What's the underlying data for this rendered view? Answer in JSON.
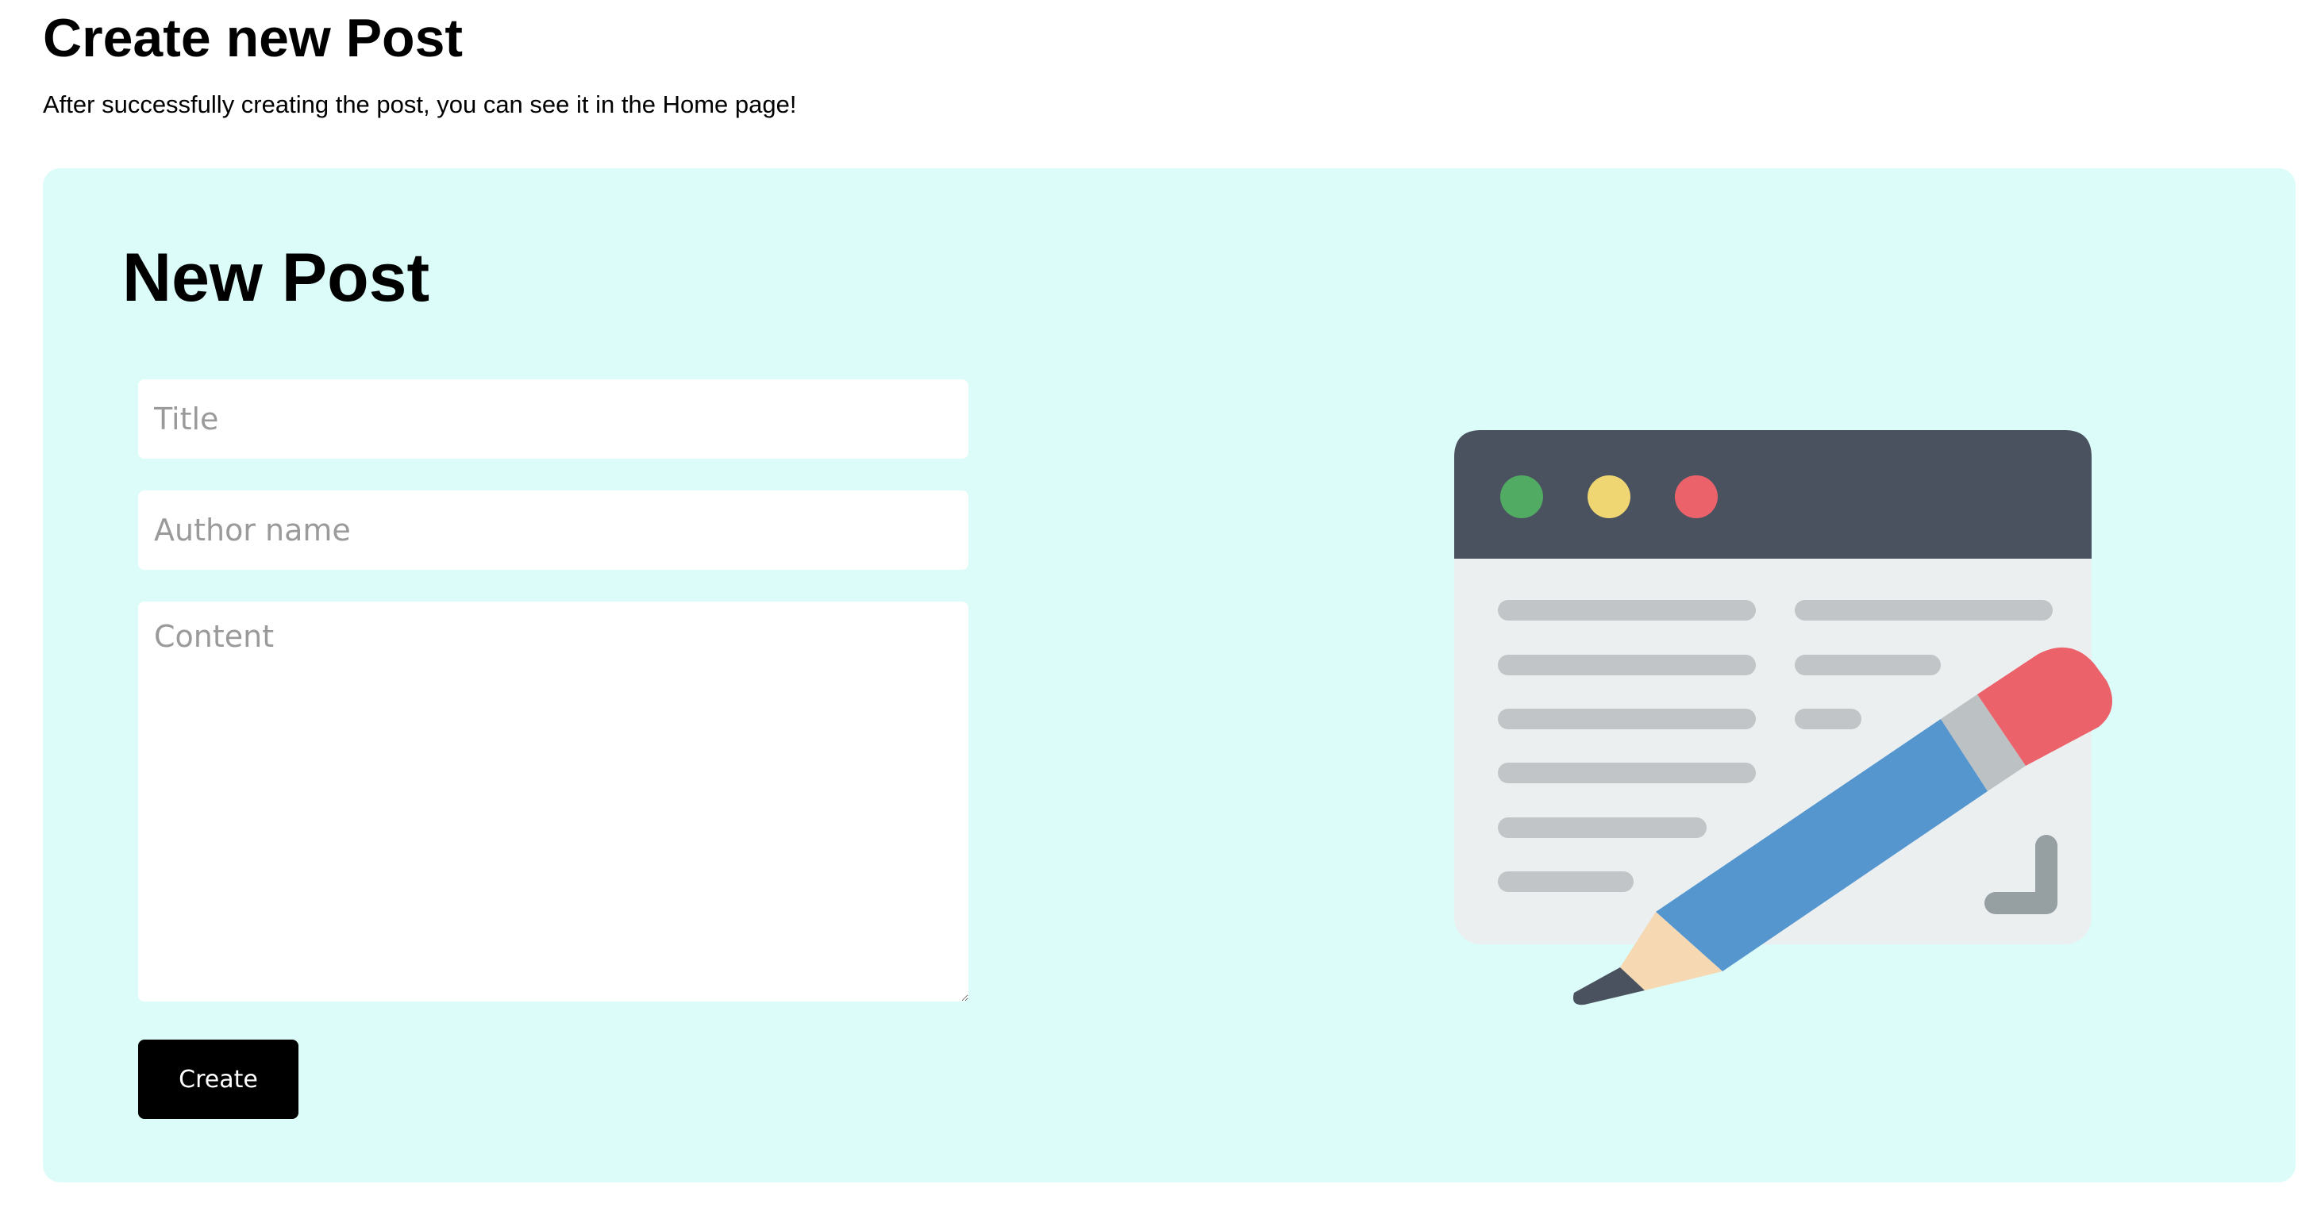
{
  "header": {
    "title": "Create new Post",
    "subtitle": "After successfully creating the post, you can see it in the Home page!"
  },
  "form": {
    "heading": "New Post",
    "title_placeholder": "Title",
    "author_placeholder": "Author name",
    "content_placeholder": "Content",
    "title_value": "",
    "author_value": "",
    "content_value": "",
    "submit_label": "Create"
  },
  "illustration": {
    "icon": "browser-window-with-pencil-icon",
    "colors": {
      "card_background": "#dcfcfa",
      "window_header": "#4a525f",
      "window_body": "#ebeff0",
      "dot_green": "#52ab62",
      "dot_yellow": "#efd672",
      "dot_red": "#ec626b",
      "text_lines": "#c1c5c7",
      "pencil_body": "#5596cf",
      "pencil_eraser": "#ec626b",
      "pencil_band": "#bcc1c3",
      "pencil_wood": "#f6d8b2",
      "pencil_tip": "#4a525f"
    }
  }
}
